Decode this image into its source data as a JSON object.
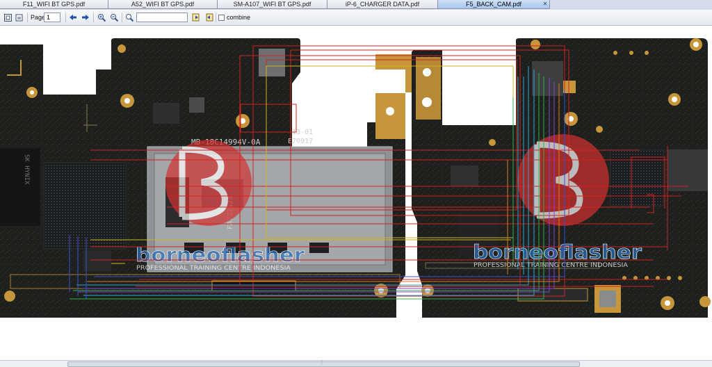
{
  "tabs": [
    {
      "label": "F11_WIFI BT GPS.pdf",
      "active": false
    },
    {
      "label": "A52_WIFI BT GPS.pdf",
      "active": false
    },
    {
      "label": "SM-A107_WIFI BT GPS.pdf",
      "active": false
    },
    {
      "label": "iP-6_CHARGER DATA.pdf",
      "active": false
    },
    {
      "label": "F5_BACK_CAM.pdf",
      "active": true
    }
  ],
  "toolbar": {
    "page_label": "Page",
    "page_value": "1",
    "search_value": "",
    "combine_label": "combine"
  },
  "boards": {
    "left_silkscreen": "MB-18C14994V-0A",
    "left_code_top": "13-01",
    "left_code": "E70917",
    "left_chip_mark": "SK HYNIX",
    "left_vertical": "FA7ZIS23"
  },
  "watermark": {
    "brand": "borneoflasher",
    "tagline": "PROFESSIONAL TRAINING CENTRE INDONESIA"
  },
  "colors": {
    "pcb": "#1c1e1a",
    "pad_gold": "#c7953a",
    "trace_red": "#d42020",
    "watermark_red": "#d23131",
    "watermark_blue": "#2b6fb6"
  }
}
